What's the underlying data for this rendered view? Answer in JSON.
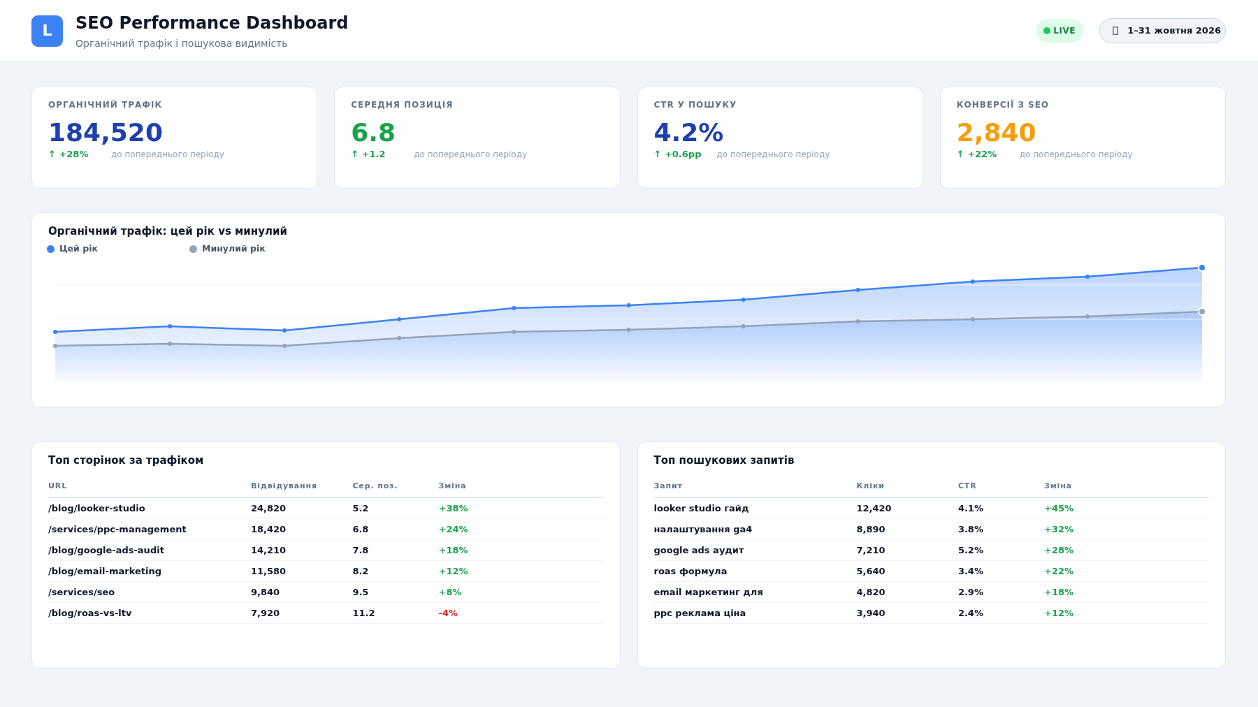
{
  "header": {
    "logo": "L",
    "title": "SEO Performance Dashboard",
    "subtitle": "Органічний трафік і пошукова видимість",
    "live_badge": "LIVE",
    "date_range": "1–31 жовтня 2026"
  },
  "kpis": [
    {
      "label": "ОРГАНІЧНИЙ ТРАФІК",
      "value": "184,520",
      "color": "#1e40af",
      "delta": "↑ +28%",
      "note": "до попереднього періоду"
    },
    {
      "label": "СЕРЕДНЯ ПОЗИЦІЯ",
      "value": "6.8",
      "color": "#16a34a",
      "delta": "↑ +1.2",
      "note": "до попереднього періоду"
    },
    {
      "label": "CTR У ПОШУКУ",
      "value": "4.2%",
      "color": "#1e40af",
      "delta": "↑ +0.6pp",
      "note": "до попереднього періоду"
    },
    {
      "label": "КОНВЕРСІЇ З SEO",
      "value": "2,840",
      "color": "#f59e0b",
      "delta": "↑ +22%",
      "note": "до попереднього періоду"
    }
  ],
  "traffic_chart": {
    "title": "Органічний трафік: цей рік vs минулий",
    "legend": [
      {
        "label": "Цей рік",
        "color": "#3b82f6"
      },
      {
        "label": "Минулий рік",
        "color": "#94a3b8"
      }
    ]
  },
  "top_pages": {
    "title": "Топ сторінок за трафіком",
    "columns": [
      "URL",
      "Відвідування",
      "Сер. поз.",
      "Зміна"
    ],
    "rows": [
      {
        "cells": [
          "/blog/looker-studio",
          "24,820",
          "5.2",
          "+38%"
        ],
        "color": "#16a34a"
      },
      {
        "cells": [
          "/services/ppc-management",
          "18,420",
          "6.8",
          "+24%"
        ],
        "color": "#16a34a"
      },
      {
        "cells": [
          "/blog/google-ads-audit",
          "14,210",
          "7.8",
          "+18%"
        ],
        "color": "#16a34a"
      },
      {
        "cells": [
          "/blog/email-marketing",
          "11,580",
          "8.2",
          "+12%"
        ],
        "color": "#16a34a"
      },
      {
        "cells": [
          "/services/seo",
          "9,840",
          "9.5",
          "+8%"
        ],
        "color": "#16a34a"
      },
      {
        "cells": [
          "/blog/roas-vs-ltv",
          "7,920",
          "11.2",
          "-4%"
        ],
        "color": "#dc2626"
      }
    ]
  },
  "top_queries": {
    "title": "Топ пошукових запитів",
    "columns": [
      "Запит",
      "Кліки",
      "CTR",
      "Зміна"
    ],
    "rows": [
      {
        "cells": [
          "looker studio гайд",
          "12,420",
          "4.1%",
          "+45%"
        ],
        "color": "#16a34a"
      },
      {
        "cells": [
          "налаштування ga4",
          "8,890",
          "3.8%",
          "+32%"
        ],
        "color": "#16a34a"
      },
      {
        "cells": [
          "google ads аудит",
          "7,210",
          "5.2%",
          "+28%"
        ],
        "color": "#16a34a"
      },
      {
        "cells": [
          "roas формула",
          "5,640",
          "3.4%",
          "+22%"
        ],
        "color": "#16a34a"
      },
      {
        "cells": [
          "email маркетинг для",
          "4,820",
          "2.9%",
          "+18%"
        ],
        "color": "#16a34a"
      },
      {
        "cells": [
          "ppc реклама ціна",
          "3,940",
          "2.4%",
          "+12%"
        ],
        "color": "#16a34a"
      }
    ]
  }
}
